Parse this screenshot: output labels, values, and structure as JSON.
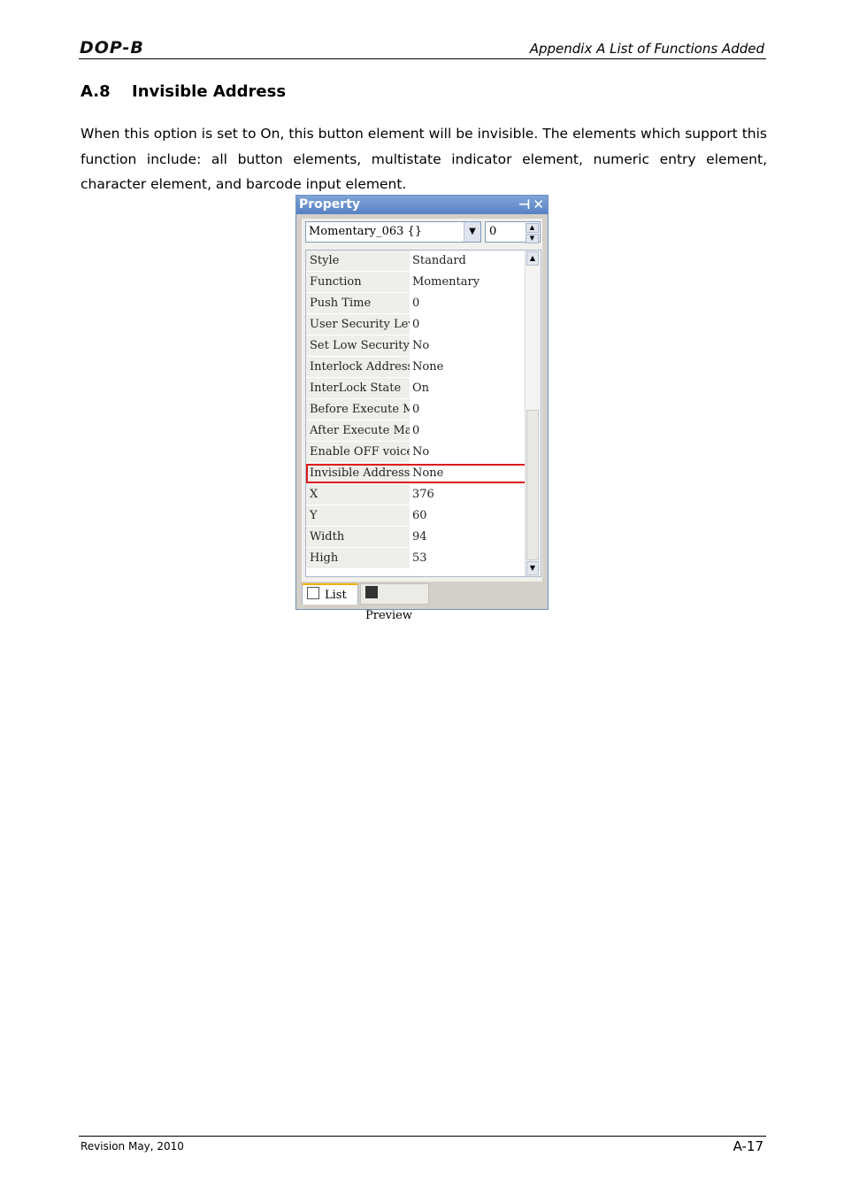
{
  "header": {
    "logo": "DOP-B",
    "title": "Appendix A List of Functions Added"
  },
  "section": {
    "number": "A.8",
    "title": "Invisible Address",
    "body": "When this option is set to On, this button element will be invisible. The elements which support this function include: all button elements, multistate indicator element, numeric entry element, character element, and barcode input element."
  },
  "property_window": {
    "title": "Property",
    "element_combo": "Momentary_063 {}",
    "spin_value": "0",
    "rows": [
      {
        "key": "Style",
        "value": "Standard"
      },
      {
        "key": "Function",
        "value": "Momentary"
      },
      {
        "key": "Push Time",
        "value": "0"
      },
      {
        "key": "User Security Level",
        "value": "0"
      },
      {
        "key": "Set Low Security",
        "value": "No"
      },
      {
        "key": "Interlock Address",
        "value": "None"
      },
      {
        "key": "InterLock State",
        "value": "On"
      },
      {
        "key": "Before Execute Mac",
        "value": "0"
      },
      {
        "key": "After Execute Macr",
        "value": "0"
      },
      {
        "key": "Enable OFF voice",
        "value": "No"
      },
      {
        "key": "Invisible Address",
        "value": "None"
      },
      {
        "key": "X",
        "value": "376"
      },
      {
        "key": "Y",
        "value": "60"
      },
      {
        "key": "Width",
        "value": "94"
      },
      {
        "key": "High",
        "value": "53"
      }
    ],
    "highlight_color": "#e01818",
    "tabs": [
      {
        "label": "List",
        "icon": "list-icon"
      },
      {
        "label": "Preview",
        "icon": "preview-icon"
      }
    ]
  },
  "footer": {
    "revision": "Revision May, 2010",
    "page": "A-17"
  }
}
